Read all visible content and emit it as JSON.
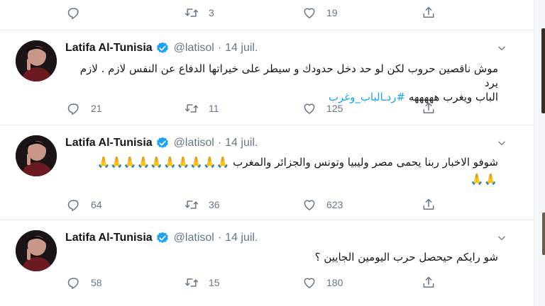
{
  "top_actions": {
    "reply": "",
    "retweet": "3",
    "like": "19"
  },
  "tweets": [
    {
      "name": "Latifa Al-Tunisia",
      "handle": "@latisol",
      "separator": "·",
      "date": "14 juil.",
      "text_line1": "موش ناقصين حروب لكن لو حد دخل حدودك و سيطر على خيراتها الدفاع عن النفس لازم . لازم يرد",
      "text_line2": "الباب ويغرب هههههه",
      "hashtag": "#ردـالباب_وغرب",
      "reply_count": "21",
      "retweet_count": "11",
      "like_count": "125"
    },
    {
      "name": "Latifa Al-Tunisia",
      "handle": "@latisol",
      "separator": "·",
      "date": "14 juil.",
      "text_line1": "شوفو الاخبار ربنا يحمى مصر وليبيا وتونس والجزائر والمغرب",
      "emoji_line1": "🙏🙏🙏🙏🙏🙏🙏🙏🙏🙏",
      "emoji_line2": "🙏🙏",
      "reply_count": "64",
      "retweet_count": "36",
      "like_count": "623"
    },
    {
      "name": "Latifa Al-Tunisia",
      "handle": "@latisol",
      "separator": "·",
      "date": "14 juil.",
      "text_line1": "شو رايكم حيحصل حرب اليومين الجايين ؟",
      "reply_count": "58",
      "retweet_count": "15",
      "like_count": "180"
    }
  ],
  "icons": {
    "reply": "reply-icon",
    "retweet": "retweet-icon",
    "like": "heart-icon",
    "share": "share-icon",
    "verified": "verified-badge-icon",
    "more": "chevron-down-icon"
  },
  "colors": {
    "verified": "#1da1f2",
    "hashtag": "#1da1f2",
    "muted": "#657786",
    "divider": "#e6ecf0"
  }
}
